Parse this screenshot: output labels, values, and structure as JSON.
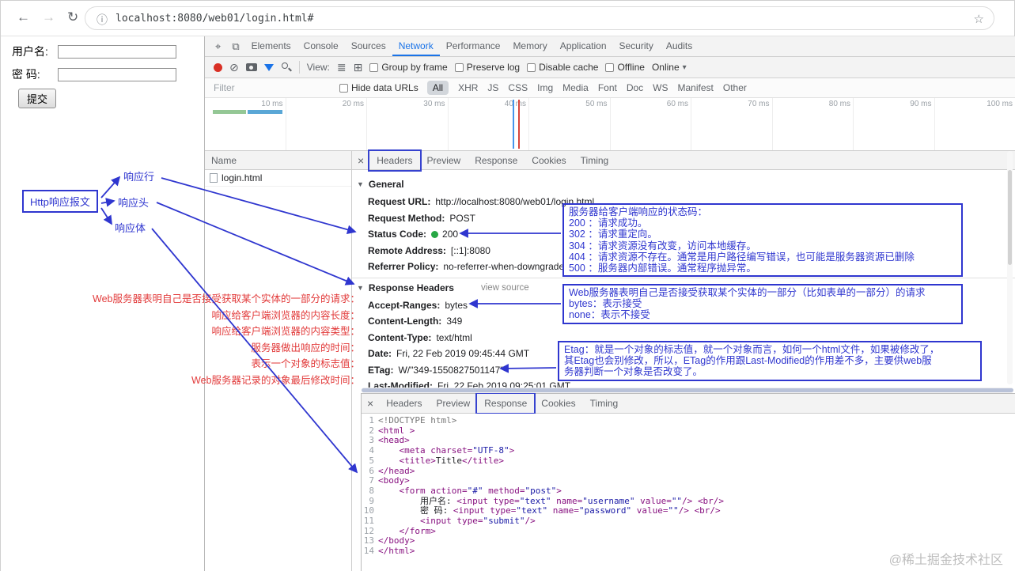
{
  "browser": {
    "url": "localhost:8080/web01/login.html#"
  },
  "page": {
    "username_label": "用户名:",
    "password_label": "密 码:",
    "submit_label": "提交"
  },
  "icons": {
    "back": "←",
    "forward": "→",
    "reload": "↻",
    "info": "ⓘ",
    "star": "☆",
    "inspect": "⌖",
    "device": "⧉",
    "clear": "⊘",
    "view_list": "≣",
    "view_grid": "⊞",
    "caret_down": "▾",
    "disclosure": "▼",
    "close": "×"
  },
  "devtools": {
    "tabs": [
      "Elements",
      "Console",
      "Sources",
      "Network",
      "Performance",
      "Memory",
      "Application",
      "Security",
      "Audits"
    ],
    "active_tab": "Network",
    "toolbar": {
      "view_label": "View:",
      "group_by_frame": "Group by frame",
      "preserve_log": "Preserve log",
      "disable_cache": "Disable cache",
      "offline": "Offline",
      "online": "Online"
    },
    "filter": {
      "placeholder": "Filter",
      "hide_data_urls": "Hide data URLs",
      "types": [
        "All",
        "XHR",
        "JS",
        "CSS",
        "Img",
        "Media",
        "Font",
        "Doc",
        "WS",
        "Manifest",
        "Other"
      ],
      "active_type": "All"
    },
    "timeline_ticks": [
      "10 ms",
      "20 ms",
      "30 ms",
      "40 ms",
      "50 ms",
      "60 ms",
      "70 ms",
      "80 ms",
      "90 ms",
      "100 ms"
    ],
    "requests": {
      "name_header": "Name",
      "rows": [
        "login.html"
      ]
    },
    "detail_tabs": [
      "Headers",
      "Preview",
      "Response",
      "Cookies",
      "Timing"
    ],
    "active_detail_tab": "Headers",
    "general": {
      "section_title": "General",
      "items": [
        {
          "key": "Request URL:",
          "value": "http://localhost:8080/web01/login.html"
        },
        {
          "key": "Request Method:",
          "value": "POST"
        },
        {
          "key": "Status Code:",
          "value": "200",
          "dot": true
        },
        {
          "key": "Remote Address:",
          "value": "[::1]:8080"
        },
        {
          "key": "Referrer Policy:",
          "value": "no-referrer-when-downgrade"
        }
      ]
    },
    "response_headers": {
      "section_title": "Response Headers",
      "view_source": "view source",
      "items": [
        {
          "key": "Accept-Ranges:",
          "value": "bytes"
        },
        {
          "key": "Content-Length:",
          "value": "349"
        },
        {
          "key": "Content-Type:",
          "value": "text/html"
        },
        {
          "key": "Date:",
          "value": "Fri, 22 Feb 2019 09:45:44 GMT"
        },
        {
          "key": "ETag:",
          "value": "W/\"349-1550827501147\""
        },
        {
          "key": "Last-Modified:",
          "value": "Fri, 22 Feb 2019 09:25:01 GMT"
        }
      ]
    },
    "response_panel": {
      "tabs": [
        "Headers",
        "Preview",
        "Response",
        "Cookies",
        "Timing"
      ],
      "active_tab": "Response",
      "code_lines": [
        "<!DOCTYPE html>",
        "<html >",
        "<head>",
        "    <meta charset=\"UTF-8\">",
        "    <title>Title</title>",
        "</head>",
        "<body>",
        "    <form action=\"#\" method=\"post\">",
        "        用户名: <input type=\"text\" name=\"username\" value=\"\"/> <br/>",
        "        密 码: <input type=\"text\" name=\"password\" value=\"\"/> <br/>",
        "        <input type=\"submit\"/>",
        "    </form>",
        "</body>",
        "</html>"
      ]
    }
  },
  "annotations": {
    "http_box_label": "Http响应报文",
    "response_line_label": "响应行",
    "response_header_label": "响应头",
    "response_body_label": "响应体",
    "red_notes": [
      "Web服务器表明自己是否接受获取某个实体的一部分的请求：",
      "响应给客户端浏览器的内容长度：",
      "响应给客户端浏览器的内容类型：",
      "服务器做出响应的时间：",
      "表示一个对象的标志值：",
      "Web服务器记录的对象最后修改时间："
    ],
    "status_box_lines": [
      "服务器给客户端响应的状态码：",
      "200 ：请求成功。",
      "302 ：请求重定向。",
      "304 ：请求资源没有改变，访问本地缓存。",
      "404 ：请求资源不存在。通常是用户路径编写错误，也可能是服务器资源已删除",
      "500 ：服务器内部错误。通常程序抛异常。"
    ],
    "accept_box_lines": [
      "Web服务器表明自己是否接受获取某个实体的一部分（比如表单的一部分）的请求",
      "bytes：表示接受",
      "none：表示不接受"
    ],
    "etag_box_lines": [
      "Etag：就是一个对象的标志值，就一个对象而言，如何一个html文件，如果被修改了，",
      "其Etag也会别修改，所以，ETag的作用跟Last-Modified的作用差不多，主要供web服",
      "务器判断一个对象是否改变了。"
    ]
  },
  "watermark": "@稀土掘金技术社区",
  "colors": {
    "annotation_blue": "#2f36cf",
    "annotation_red": "#e23b3b",
    "status_green": "#27a744",
    "accent_blue": "#1a73e8",
    "record_red": "#d93025"
  }
}
